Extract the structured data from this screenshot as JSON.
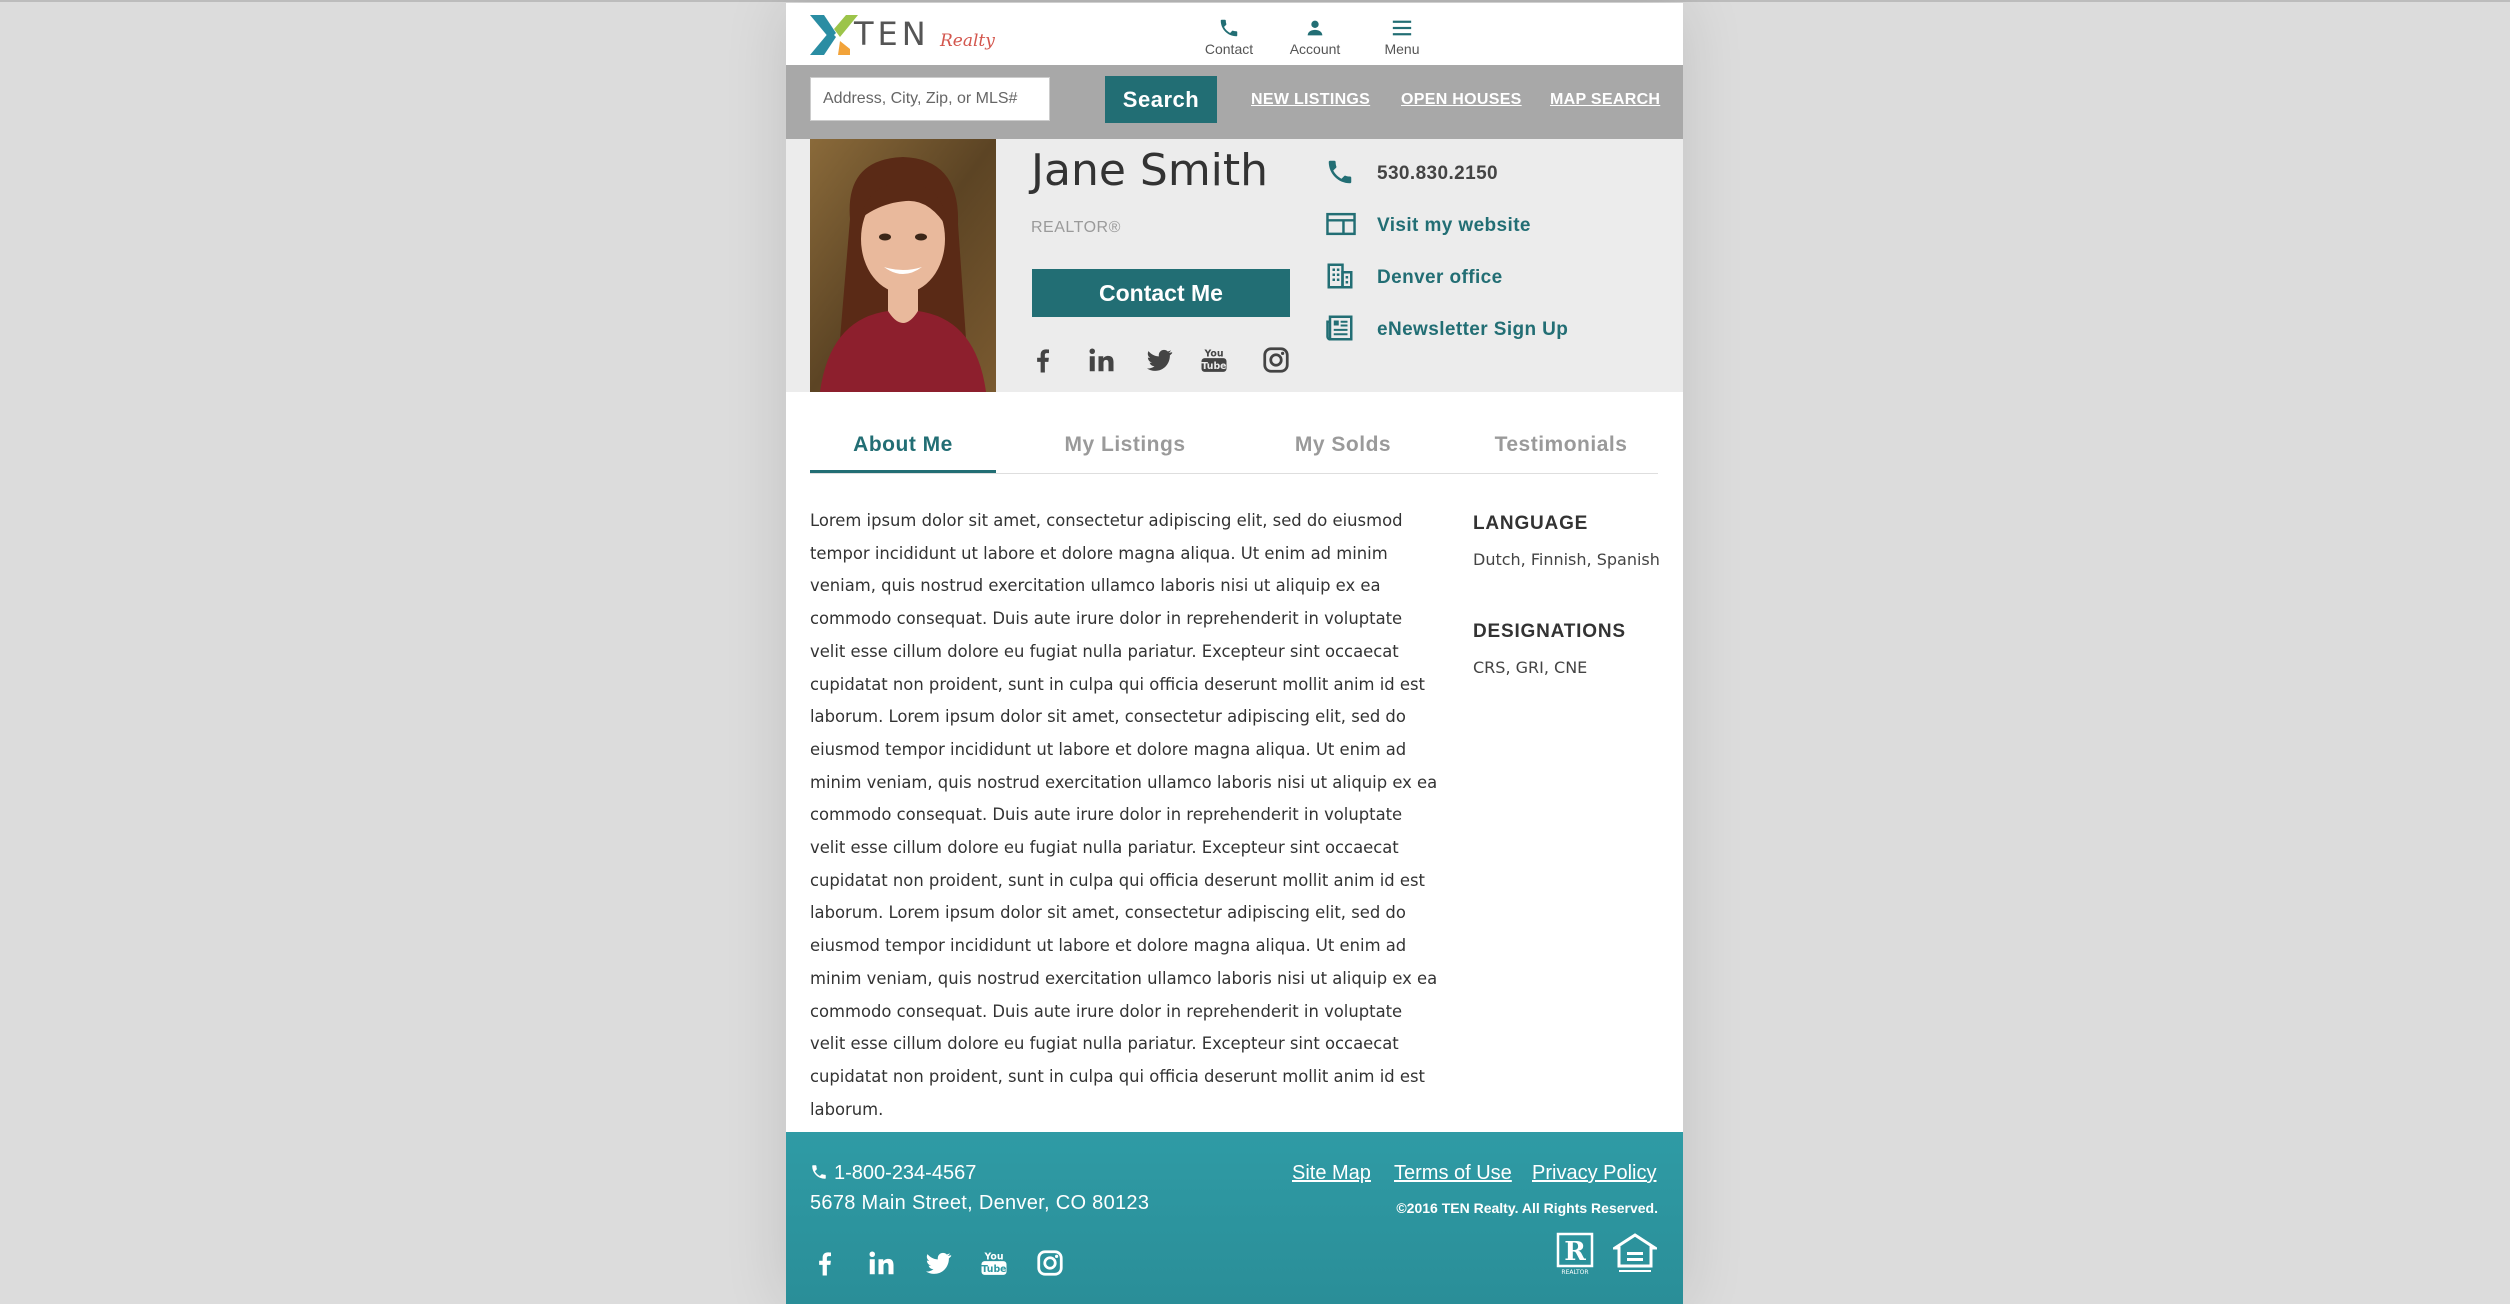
{
  "brand": {
    "name": "TEN",
    "sub": "Realty"
  },
  "header_nav": [
    {
      "label": "Contact",
      "icon": "phone-icon"
    },
    {
      "label": "Account",
      "icon": "account-icon"
    },
    {
      "label": "Menu",
      "icon": "menu-icon"
    }
  ],
  "search": {
    "placeholder": "Address, City, Zip, or MLS#",
    "button": "Search",
    "links": [
      "NEW LISTINGS",
      "OPEN HOUSES",
      "MAP SEARCH"
    ]
  },
  "agent": {
    "name": "Jane Smith",
    "title": "REALTOR®",
    "contact_button": "Contact Me",
    "social": [
      "facebook-icon",
      "linkedin-icon",
      "twitter-icon",
      "youtube-icon",
      "instagram-icon"
    ],
    "contacts": [
      {
        "icon": "phone-icon",
        "text": "530.830.2150"
      },
      {
        "icon": "website-icon",
        "text": "Visit my website"
      },
      {
        "icon": "office-building-icon",
        "text": "Denver office"
      },
      {
        "icon": "newsletter-icon",
        "text": "eNewsletter Sign Up"
      }
    ]
  },
  "tabs": [
    "About Me",
    "My Listings",
    "My Solds",
    "Testimonials"
  ],
  "active_tab": "About Me",
  "about_text": "Lorem ipsum dolor sit amet, consectetur adipiscing elit, sed do eiusmod tempor incididunt ut labore et dolore magna aliqua. Ut enim ad minim veniam, quis nostrud exercitation ullamco laboris nisi ut aliquip ex ea commodo consequat. Duis aute irure dolor in reprehenderit in voluptate velit esse cillum dolore eu fugiat nulla pariatur. Excepteur sint occaecat cupidatat non proident, sunt in culpa qui officia deserunt mollit anim id est laborum. Lorem ipsum dolor sit amet, consectetur adipiscing elit, sed do eiusmod tempor incididunt ut labore et dolore magna aliqua. Ut enim ad minim veniam, quis nostrud exercitation ullamco laboris nisi ut aliquip ex ea commodo consequat. Duis aute irure dolor in reprehenderit in voluptate velit esse cillum dolore eu fugiat nulla pariatur. Excepteur sint occaecat cupidatat non proident, sunt in culpa qui officia deserunt mollit anim id est laborum. Lorem ipsum dolor sit amet, consectetur adipiscing elit, sed do eiusmod tempor incididunt ut labore et dolore magna aliqua. Ut enim ad minim veniam, quis nostrud exercitation ullamco laboris nisi ut aliquip ex ea commodo consequat. Duis aute irure dolor in reprehenderit in voluptate velit esse cillum dolore eu fugiat nulla pariatur. Excepteur sint occaecat cupidatat non proident, sunt in culpa qui officia deserunt mollit anim id est laborum.",
  "sidebar": {
    "language_heading": "LANGUAGE",
    "language_value": "Dutch, Finnish, Spanish",
    "designations_heading": "DESIGNATIONS",
    "designations_value": "CRS, GRI, CNE"
  },
  "footer": {
    "phone": "1-800-234-4567",
    "address": "5678 Main Street, Denver, CO 80123",
    "links": [
      "Site Map",
      "Terms of Use",
      "Privacy Policy"
    ],
    "copyright": "©2016 TEN Realty. All Rights Reserved.",
    "badge_realtor": "REALTOR",
    "social": [
      "facebook-icon",
      "linkedin-icon",
      "twitter-icon",
      "youtube-icon",
      "instagram-icon"
    ]
  },
  "colors": {
    "accent": "#226e74",
    "footer": "#2f9ba5",
    "logo_blue": "#2a8da3",
    "logo_green": "#9cc44a",
    "logo_orange": "#f2a33a",
    "realty_red": "#d3564d"
  }
}
